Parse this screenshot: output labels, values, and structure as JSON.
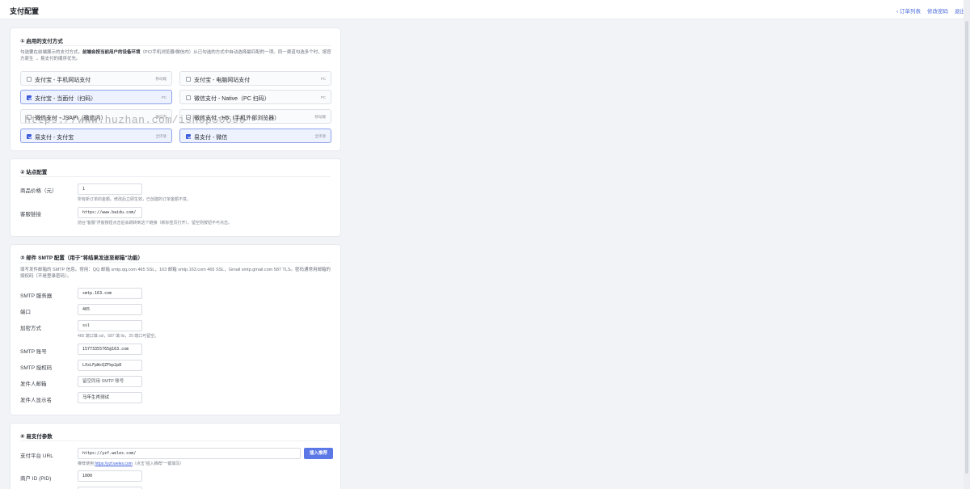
{
  "header": {
    "title": "支付配置",
    "links": [
      "‹ 订单列表",
      "修改密码",
      "退出"
    ]
  },
  "payment_methods": {
    "title": "① 启用的支付方式",
    "desc_prefix": "勾选要在前端展示的支付方式。",
    "desc_bold": "前端会按当前用户的设备环境",
    "desc_suffix": "（PC/手机浏览器/微信内）从已勾选的方式中自动选择最匹配的一项。同一渠道勾选多个时，按官方原生 → 易支付的顺序优先。",
    "options": [
      {
        "label": "支付宝 - 手机网站支付",
        "tag": "移动端",
        "checked": false
      },
      {
        "label": "支付宝 - 电脑网站支付",
        "tag": "PC",
        "checked": false
      },
      {
        "label": "支付宝 - 当面付（扫码）",
        "tag": "PC",
        "checked": true
      },
      {
        "label": "微信支付 - Native（PC 扫码）",
        "tag": "PC",
        "checked": false
      },
      {
        "label": "微信支付 - JSAPI（微信内）",
        "tag": "微信内",
        "checked": false
      },
      {
        "label": "微信支付 - H5（手机外部浏览器）",
        "tag": "移动端",
        "checked": false
      },
      {
        "label": "易支付 - 支付宝",
        "tag": "全环境",
        "checked": true
      },
      {
        "label": "易支付 - 微信",
        "tag": "全环境",
        "checked": true
      }
    ]
  },
  "watermark": "https://www.huzhan.com/ishop50696",
  "site": {
    "title": "② 站点配置",
    "price_label": "商品价格（元）",
    "price_value": "1",
    "price_hint": "所有新订单的金额。修改后立即生效，已创建的订单金额不变。",
    "service_label": "客服链接",
    "service_value": "https://www.baidu.com/",
    "service_hint": "前台\"客服\"浮窗按钮点击后会跳转到这个链接（新标签页打开）。留空则按钮不可点击。"
  },
  "smtp": {
    "title": "③ 邮件 SMTP 配置（用于\"将结果发送至邮箱\"功能）",
    "desc": "填写发件邮箱的 SMTP 信息。常用：QQ 邮箱 smtp.qq.com 465 SSL，163 邮箱 smtp.163.com 465 SSL，Gmail smtp.gmail.com 587 TLS。密码通常用邮箱的 授权码（不是登录密码）。",
    "fields": [
      {
        "label": "SMTP 服务器",
        "value": "smtp.163.com"
      },
      {
        "label": "端口",
        "value": "465"
      },
      {
        "label": "加密方式",
        "value": "ssl"
      },
      {
        "label": "SMTP 账号",
        "value": "15773355765@163.com"
      },
      {
        "label": "SMTP 授权码",
        "value": "LXxLFpWcQZFkp2p8"
      },
      {
        "label": "发件人邮箱",
        "value": "留空同用 SMTP 账号"
      },
      {
        "label": "发件人显示名",
        "value": "马年生肖测试"
      }
    ],
    "encrypt_hint": "465 端口填 ssl，587 填 tls，25 端口可留空。"
  },
  "epay": {
    "title": "④ 易支付参数",
    "url_label": "支付平台 URL",
    "url_value": "https://yzf.weles.com/",
    "insert_button": "插入推荐",
    "hint_prefix": "推荐使用 ",
    "hint_link": "https://yzf.weles.com",
    "hint_suffix": "（点击\"插入推荐\"一键填写）",
    "pid_label": "商户 ID (PID)",
    "pid_value": "1000"
  },
  "colors": {
    "accent": "#3b5bdb",
    "button": "#5b78e6",
    "page_bg": "#f1f3f7"
  }
}
